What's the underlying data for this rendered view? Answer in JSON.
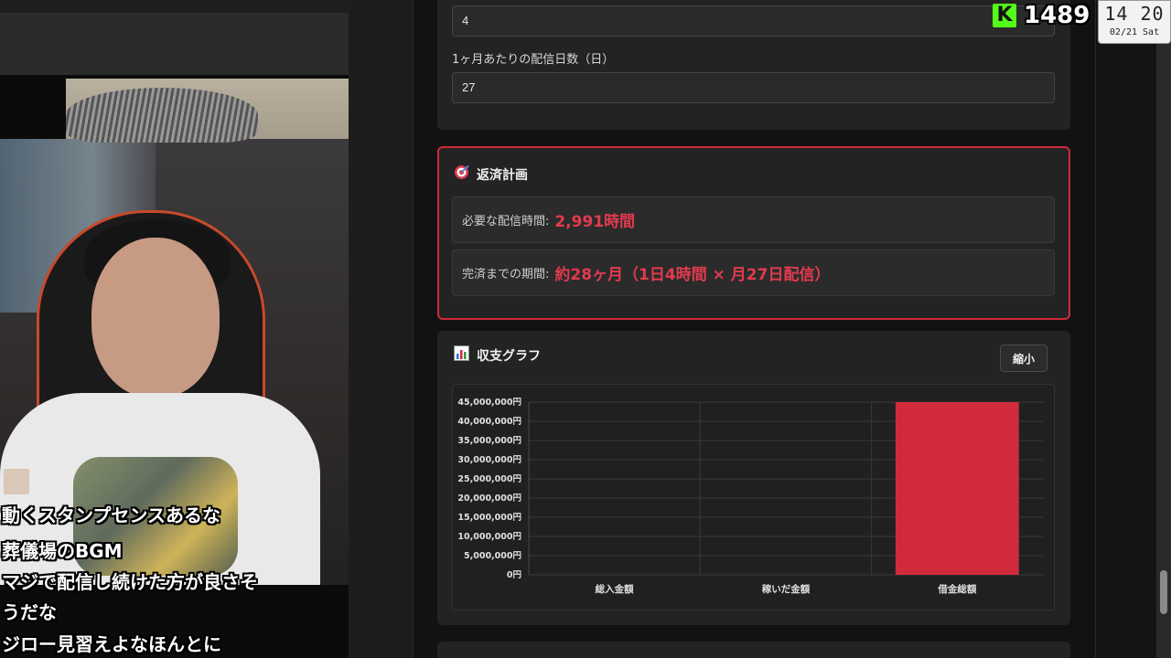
{
  "chat": {
    "lines": [
      "動くスタンプセンスあるな",
      "葬儀場のBGM",
      "マジで配信し続けた方が良さそ",
      "うだな",
      "ジロー見習えよなほんとに"
    ]
  },
  "form": {
    "partial_value": "4",
    "days_label": "1ヶ月あたりの配信日数（日）",
    "days_value": "27"
  },
  "plan": {
    "title": "返済計画",
    "icon": "target-icon",
    "hours_label": "必要な配信時間:",
    "hours_value": "2,991時間",
    "period_label": "完済までの期間:",
    "period_value": "約28ヶ月（1日4時間 × 月27日配信）",
    "accent": "#e23a4e",
    "border": "#d0293b"
  },
  "graph": {
    "title": "収支グラフ",
    "icon": "bar-chart-icon",
    "shrink_label": "縮小"
  },
  "chart_data": {
    "type": "bar",
    "categories": [
      "総入金額",
      "稼いだ金額",
      "借金総額"
    ],
    "values": [
      0,
      0,
      45000000
    ],
    "ylim": [
      0,
      45000000
    ],
    "yticks": [
      "0円",
      "5,000,000円",
      "10,000,000円",
      "15,000,000円",
      "20,000,000円",
      "25,000,000円",
      "30,000,000円",
      "35,000,000円",
      "40,000,000円",
      "45,000,000円"
    ],
    "bar_color": "#d12a3c",
    "grid": true
  },
  "badges": {
    "kick_letter": "K",
    "kick_count": "1489",
    "clock_time": "14 20",
    "clock_date": "02/21 Sat"
  }
}
